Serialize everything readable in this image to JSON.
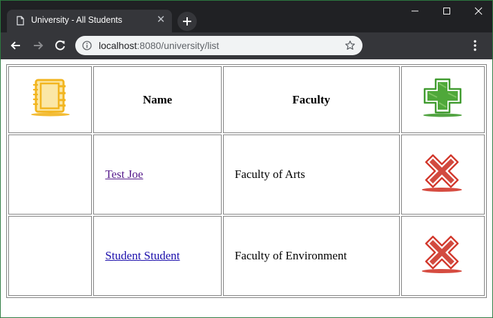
{
  "browser": {
    "tab_title": "University - All Students",
    "url_host": "localhost",
    "url_rest": ":8080/university/list"
  },
  "table": {
    "headers": {
      "name": "Name",
      "faculty": "Faculty"
    },
    "rows": [
      {
        "name": "Test Joe",
        "faculty": "Faculty of Arts"
      },
      {
        "name": "Student Student",
        "faculty": "Faculty of Environment"
      }
    ]
  },
  "icons": {
    "header_left": "notebook-icon",
    "header_right": "add-plus-icon",
    "row_action": "delete-x-icon"
  },
  "colors": {
    "notebook": "#f2b51f",
    "add": "#3f9a2e",
    "delete": "#d2382c",
    "link": "#1a0dab",
    "link_visited": "#551a8b"
  }
}
